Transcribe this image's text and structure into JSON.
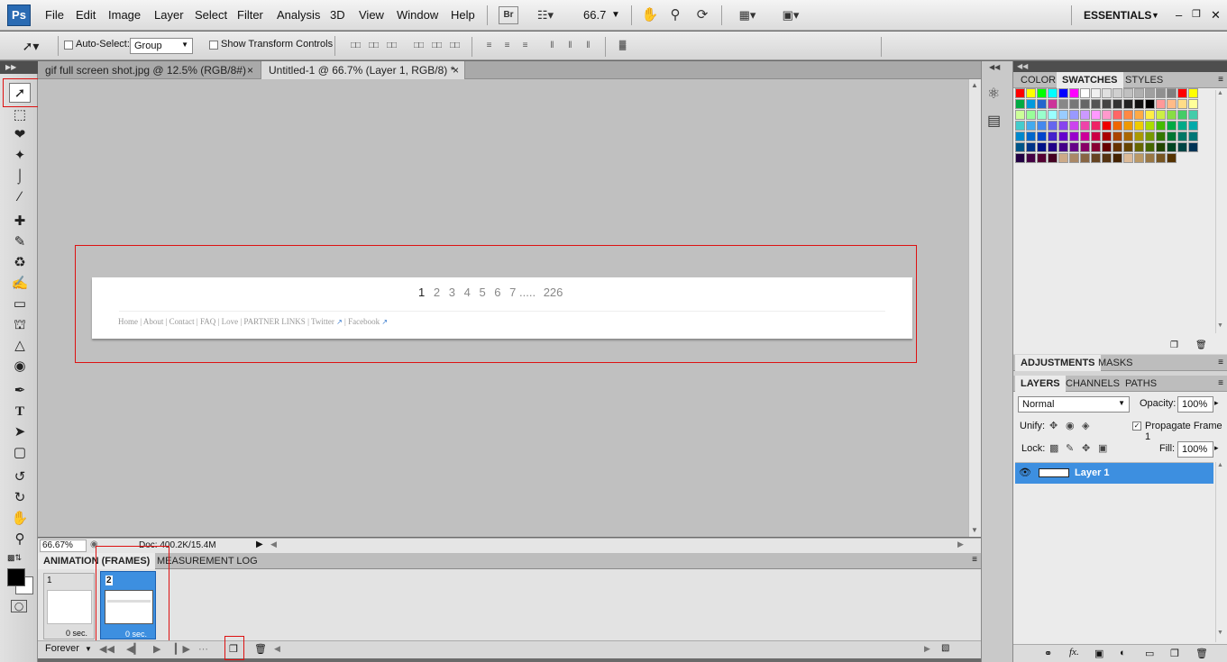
{
  "app": {
    "logo": "Ps",
    "workspace": "ESSENTIALS",
    "zoom_menu": "66.7"
  },
  "menu": [
    "File",
    "Edit",
    "Image",
    "Layer",
    "Select",
    "Filter",
    "Analysis",
    "3D",
    "View",
    "Window",
    "Help"
  ],
  "options": {
    "auto_select_label": "Auto-Select:",
    "auto_select_value": "Group",
    "transform_label": "Show Transform Controls"
  },
  "tabs": [
    {
      "label": "gif full screen shot.jpg @ 12.5% (RGB/8#)"
    },
    {
      "label": "Untitled-1 @ 66.7% (Layer 1, RGB/8) *"
    }
  ],
  "canvas": {
    "pages": [
      "1",
      "2",
      "3",
      "4",
      "5",
      "6",
      "7",
      ".....",
      "226"
    ],
    "footer_links": [
      "Home",
      "|",
      "About",
      "|",
      "Contact",
      "|",
      "FAQ",
      "|",
      "Love",
      "|",
      "PARTNER LINKS",
      "|",
      "Twitter",
      "|",
      "Facebook"
    ]
  },
  "status": {
    "zoom": "66.67%",
    "doc": "Doc: 400.2K/15.4M"
  },
  "animation": {
    "tabs": [
      "ANIMATION (FRAMES)",
      "MEASUREMENT LOG"
    ],
    "frames": [
      {
        "num": "1",
        "delay": "0 sec."
      },
      {
        "num": "2",
        "delay": "0 sec."
      }
    ],
    "loop": "Forever"
  },
  "color_panel": {
    "tabs": [
      "COLOR",
      "SWATCHES",
      "STYLES"
    ]
  },
  "adjust_panel": {
    "tabs": [
      "ADJUSTMENTS",
      "MASKS"
    ]
  },
  "layers_panel": {
    "tabs": [
      "LAYERS",
      "CHANNELS",
      "PATHS"
    ],
    "blend_mode": "Normal",
    "opacity_label": "Opacity:",
    "opacity": "100%",
    "unify_label": "Unify:",
    "propagate": "Propagate Frame 1",
    "lock_label": "Lock:",
    "fill_label": "Fill:",
    "fill": "100%",
    "layer_name": "Layer 1"
  },
  "swatch_colors": [
    [
      "#ff0000",
      "#ffff00",
      "#00ff00",
      "#00ffff",
      "#0000ff",
      "#ff00ff",
      "#ffffff",
      "#f0f0f0",
      "#e0e0e0",
      "#d0d0d0",
      "#c0c0c0",
      "#b0b0b0",
      "#a0a0a0",
      "#909090",
      "#808080",
      "#ff0000",
      "#ffff00"
    ],
    [
      "#00aa44",
      "#0099dd",
      "#2266cc",
      "#cc3399",
      "#888888",
      "#777777",
      "#666666",
      "#555555",
      "#444444",
      "#333333",
      "#222222",
      "#111111",
      "#000000",
      "#ff9999",
      "#ffbb88",
      "#ffdd88",
      "#ffff99"
    ],
    [
      "#ccff99",
      "#99ff99",
      "#99ffcc",
      "#99ffff",
      "#99ccff",
      "#9999ff",
      "#cc99ff",
      "#ff99ff",
      "#ff99cc",
      "#ff6666",
      "#ff8844",
      "#ffaa44",
      "#ffee44",
      "#ccee44",
      "#88dd44",
      "#44cc66",
      "#44ccaa"
    ],
    [
      "#44cccc",
      "#44aaee",
      "#4488ee",
      "#6666ee",
      "#8844ee",
      "#cc44ee",
      "#ee44aa",
      "#ee2266",
      "#ee0000",
      "#ee6600",
      "#ee9900",
      "#eecc00",
      "#aadd00",
      "#44bb00",
      "#00aa44",
      "#00aa88",
      "#00aaaa"
    ],
    [
      "#0088cc",
      "#0066cc",
      "#0044cc",
      "#4422cc",
      "#6600cc",
      "#9900cc",
      "#cc0099",
      "#cc0044",
      "#aa0000",
      "#aa4400",
      "#aa6600",
      "#aa9900",
      "#779900",
      "#337700",
      "#007733",
      "#007766",
      "#007777"
    ],
    [
      "#005588",
      "#003388",
      "#001188",
      "#220088",
      "#440088",
      "#660088",
      "#880066",
      "#880033",
      "#660000",
      "#663300",
      "#664400",
      "#666600",
      "#446600",
      "#224400",
      "#004422",
      "#004444",
      "#003355"
    ],
    [
      "#220044",
      "#440044",
      "#550033",
      "#440022",
      "#ccaa88",
      "#aa8866",
      "#886644",
      "#664422",
      "#553311",
      "#442200",
      "#ddbb99",
      "#bb9966",
      "#997744",
      "#775522",
      "#553300"
    ]
  ]
}
